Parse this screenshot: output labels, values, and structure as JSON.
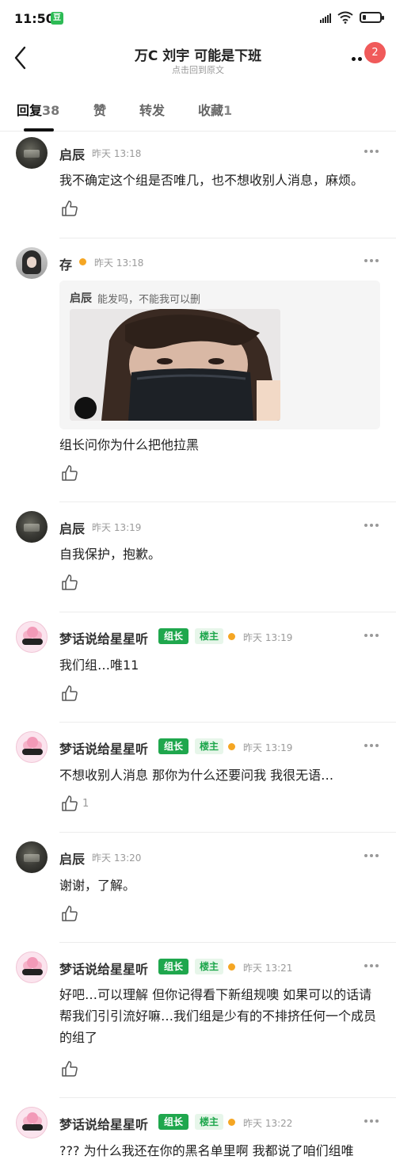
{
  "status": {
    "time": "11:50",
    "app_badge": "豆"
  },
  "header": {
    "title": "万C 刘宇 可能是下班",
    "subtitle": "点击回到原文",
    "badge": "2"
  },
  "tabs": [
    {
      "label": "回复",
      "count": "38"
    },
    {
      "label": "赞",
      "count": ""
    },
    {
      "label": "转发",
      "count": ""
    },
    {
      "label": "收藏",
      "count": "1"
    }
  ],
  "comments": [
    {
      "name": "启辰",
      "time": "昨天 13:18",
      "text": "我不确定这个组是否唯几，也不想收别人消息，麻烦。"
    },
    {
      "name": "存",
      "time": "昨天 13:18",
      "quote_name": "启辰",
      "quote_text": "能发吗，不能我可以删",
      "text": "组长问你为什么把他拉黑"
    },
    {
      "name": "启辰",
      "time": "昨天 13:19",
      "text": "自我保护，抱歉。"
    },
    {
      "name": "梦话说给星星听",
      "tag_role": "组长",
      "tag_owner": "楼主",
      "time": "昨天 13:19",
      "text": "我们组…唯11"
    },
    {
      "name": "梦话说给星星听",
      "tag_role": "组长",
      "tag_owner": "楼主",
      "time": "昨天 13:19",
      "text": "不想收别人消息 那你为什么还要问我 我很无语…",
      "likes": "1"
    },
    {
      "name": "启辰",
      "time": "昨天 13:20",
      "text": "谢谢，了解。"
    },
    {
      "name": "梦话说给星星听",
      "tag_role": "组长",
      "tag_owner": "楼主",
      "time": "昨天 13:21",
      "text": "好吧…可以理解 但你记得看下新组规噢 如果可以的话请帮我们引引流好嘛…我们组是少有的不排挤任何一个成员的组了"
    },
    {
      "name": "梦话说给星星听",
      "tag_role": "组长",
      "tag_owner": "楼主",
      "time": "昨天 13:22",
      "text": "??? 为什么我还在你的黑名单里啊 我都说了咱们组唯"
    }
  ],
  "icons": {
    "back": "chevron-left-icon",
    "more": "more-icon",
    "like": "thumbs-up-icon",
    "wifi": "wifi-icon",
    "signal": "signal-icon",
    "battery": "battery-icon"
  },
  "colors": {
    "group_leader_tag": "#1fa74d",
    "owner_tag_bg": "#e7f6ea",
    "notification": "#f05a5a",
    "active_dot": "#f5a623"
  }
}
